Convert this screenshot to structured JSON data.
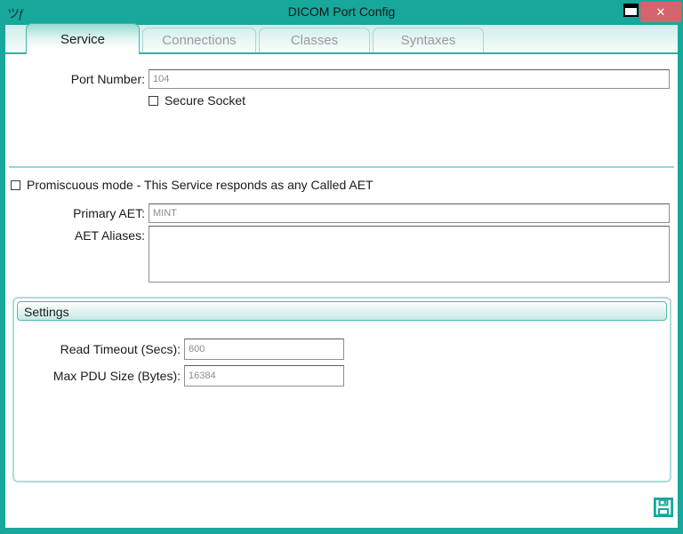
{
  "window": {
    "title": "DICOM Port Config",
    "app_icon_glyph": "ツƒ",
    "close_glyph": "✕"
  },
  "tabs": [
    {
      "label": "Service",
      "active": true
    },
    {
      "label": "Connections",
      "active": false
    },
    {
      "label": "Classes",
      "active": false
    },
    {
      "label": "Syntaxes",
      "active": false
    }
  ],
  "service": {
    "port_number": {
      "label": "Port Number:",
      "value": "104"
    },
    "secure_socket": {
      "label": "Secure Socket",
      "checked": false
    },
    "promiscuous": {
      "label": "Promiscuous mode - This Service responds as any Called AET",
      "checked": false
    },
    "primary_aet": {
      "label": "Primary AET:",
      "value": "MINT"
    },
    "aet_aliases": {
      "label": "AET Aliases:",
      "value": ""
    },
    "settings": {
      "title": "Settings",
      "read_timeout": {
        "label": "Read Timeout (Secs):",
        "value": "600"
      },
      "max_pdu_size": {
        "label": "Max PDU Size (Bytes):",
        "value": "16384"
      }
    }
  },
  "colors": {
    "frame_teal": "#17a79b",
    "close_button": "#d5646c",
    "tab_border": "#9fd9d3",
    "active_tab_border": "#44b5ab",
    "divider": "#93d9d3",
    "groupbox_border": "#a9ded9",
    "input_text": "#8c8c8c"
  }
}
